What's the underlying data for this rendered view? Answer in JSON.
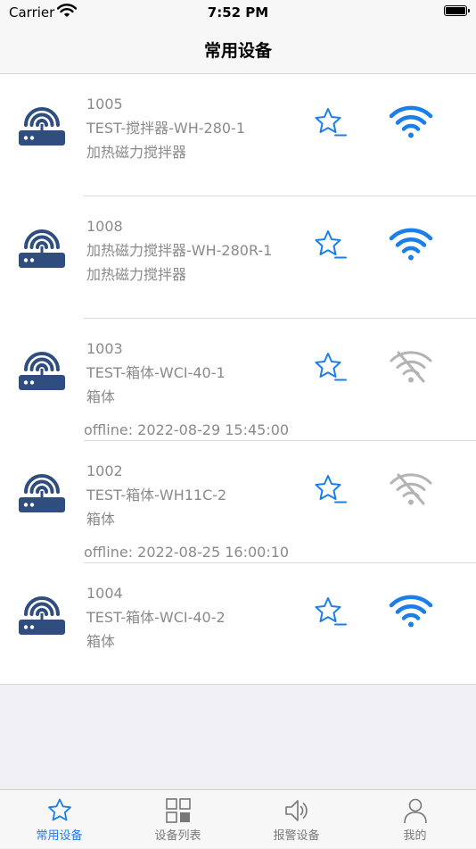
{
  "status_bar": {
    "carrier": "Carrier",
    "time": "7:52 PM"
  },
  "nav": {
    "title": "常用设备"
  },
  "colors": {
    "accent": "#1a7fe8",
    "router": "#2f4d7f",
    "offline": "#b3b3b3"
  },
  "devices": [
    {
      "id": "1005",
      "name": "TEST-搅拌器-WH-280-1",
      "type": "加热磁力搅拌器",
      "offline": "",
      "online": true
    },
    {
      "id": "1008",
      "name": "加热磁力搅拌器-WH-280R-1",
      "type": "加热磁力搅拌器",
      "offline": "",
      "online": true
    },
    {
      "id": "1003",
      "name": "TEST-箱体-WCI-40-1",
      "type": "箱体",
      "offline": "offline: 2022-08-29 15:45:00",
      "online": false
    },
    {
      "id": "1002",
      "name": "TEST-箱体-WH11C-2",
      "type": "箱体",
      "offline": "offline: 2022-08-25 16:00:10",
      "online": false
    },
    {
      "id": "1004",
      "name": "TEST-箱体-WCI-40-2",
      "type": "箱体",
      "offline": "",
      "online": true
    }
  ],
  "icons": {
    "device": "router-icon",
    "favorite": "star-minus-icon",
    "online": "wifi-icon",
    "offline": "wifi-off-icon"
  },
  "tabs": [
    {
      "label": "常用设备",
      "icon": "star-icon",
      "active": true
    },
    {
      "label": "设备列表",
      "icon": "grid-icon",
      "active": false
    },
    {
      "label": "报警设备",
      "icon": "speaker-icon",
      "active": false
    },
    {
      "label": "我的",
      "icon": "person-icon",
      "active": false
    }
  ]
}
